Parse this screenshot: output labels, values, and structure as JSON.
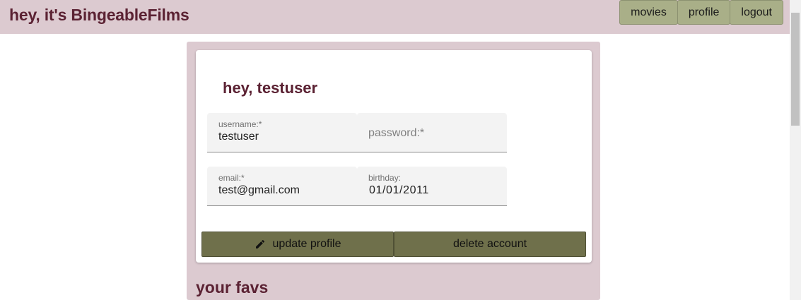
{
  "header": {
    "brand": "hey, it's BingeableFilms"
  },
  "nav": {
    "movies": "movies",
    "profile": "profile",
    "logout": "logout"
  },
  "profile_card": {
    "greeting": "hey, testuser",
    "username": {
      "label": "username:*",
      "value": "testuser"
    },
    "password": {
      "placeholder": "password:*",
      "value": ""
    },
    "email": {
      "label": "email:*",
      "value": "test@gmail.com"
    },
    "birthday": {
      "label": "birthday:",
      "value": "01/01/2011"
    },
    "update_label": "update profile",
    "update_icon": "pencil-icon",
    "delete_label": "delete account"
  },
  "favs": {
    "heading": "your favs"
  },
  "colors": {
    "brand": "#5b2233",
    "header_bg": "#dccad0",
    "nav_button": "#a9af88",
    "action_button": "#6f704b"
  }
}
